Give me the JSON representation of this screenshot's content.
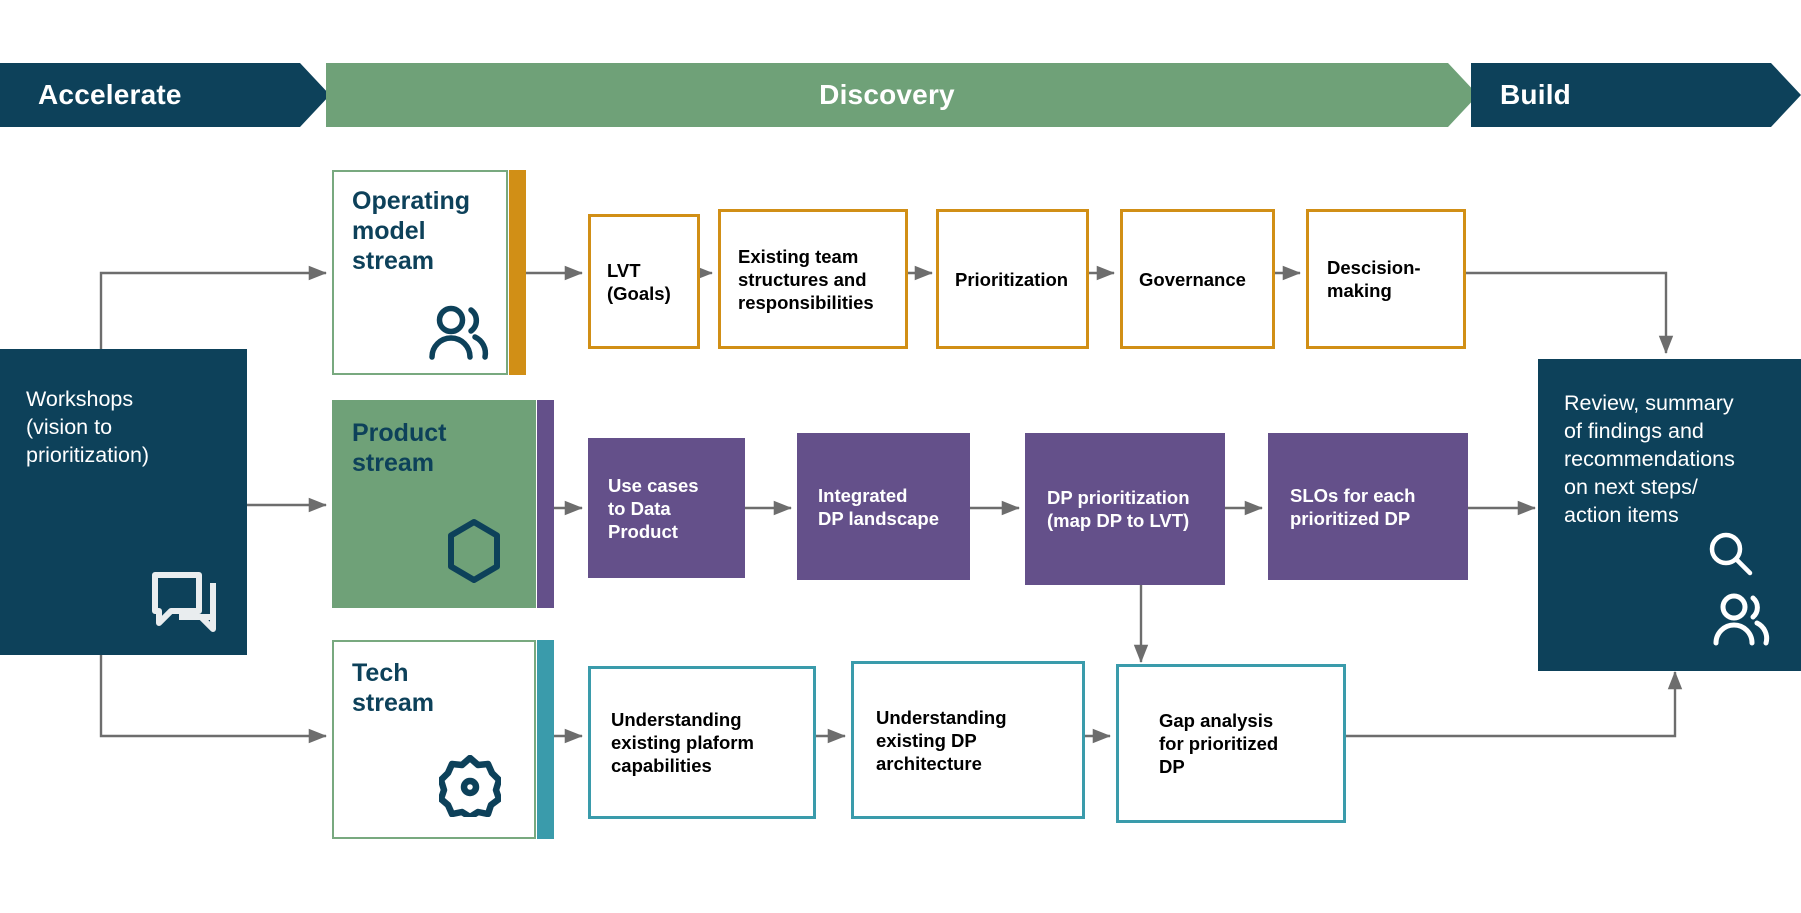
{
  "banner": {
    "phases": [
      {
        "label": "Accelerate",
        "color": "#0d415a",
        "text_color": "#ffffff"
      },
      {
        "label": "Discovery",
        "color": "#6fa178",
        "text_color": "#ffffff"
      },
      {
        "label": "Build",
        "color": "#0d415a",
        "text_color": "#ffffff"
      }
    ]
  },
  "start_node": {
    "label": "Workshops\n(vision to\nprioritization)",
    "icon": "chat-bubbles-icon",
    "color": "#0d415a"
  },
  "end_node": {
    "label": "Review, summary\nof findings and\nrecommendations\non next steps/\naction items",
    "icons": [
      "magnifier-icon",
      "people-icon"
    ],
    "color": "#0d415a"
  },
  "streams": [
    {
      "id": "operating-model",
      "title": "Operating\nmodel\nstream",
      "icon": "people-icon",
      "accent_color": "#d18f16",
      "fill": "#ffffff",
      "border": "#78a97f",
      "steps": [
        {
          "label": "LVT\n(Goals)"
        },
        {
          "label": "Existing team\nstructures and\nresponsibilities"
        },
        {
          "label": "Prioritization"
        },
        {
          "label": "Governance"
        },
        {
          "label": "Descision-\nmaking"
        }
      ]
    },
    {
      "id": "product",
      "title": "Product\nstream",
      "icon": "hexagon-icon",
      "accent_color": "#64508a",
      "fill": "#6fa178",
      "border": "#6fa178",
      "steps": [
        {
          "label": "Use cases\nto Data\nProduct"
        },
        {
          "label": "Integrated\nDP landscape"
        },
        {
          "label": "DP prioritization\n(map DP to LVT)"
        },
        {
          "label": "SLOs for each\nprioritized DP"
        }
      ]
    },
    {
      "id": "tech",
      "title": "Tech\nstream",
      "icon": "gear-icon",
      "accent_color": "#3a9bab",
      "fill": "#ffffff",
      "border": "#78a97f",
      "steps": [
        {
          "label": "Understanding\nexisting plaform\ncapabilities"
        },
        {
          "label": "Understanding\nexisting DP\narchitecture"
        },
        {
          "label": "Gap analysis\nfor prioritized\nDP"
        }
      ]
    }
  ],
  "colors": {
    "dark_teal": "#0d415a",
    "green": "#6fa178",
    "orange": "#d18f16",
    "purple": "#64508a",
    "teal": "#3a9bab",
    "connector_gray": "#6d6d6d"
  }
}
